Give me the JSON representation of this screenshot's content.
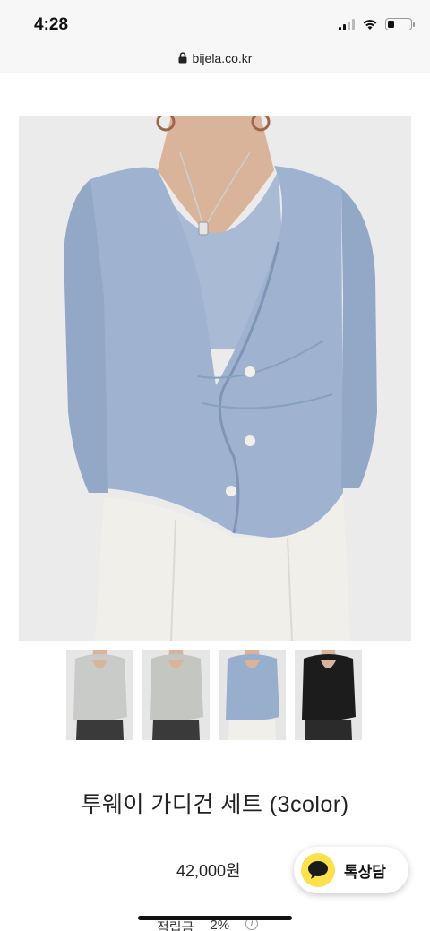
{
  "status_bar": {
    "time": "4:28",
    "battery_level": 0.3
  },
  "browser": {
    "url": "bijela.co.kr"
  },
  "product": {
    "title": "투웨이 가디건 세트 (3color)",
    "price": "42,000원",
    "points_label": "적립금",
    "points_value": "2%",
    "info_symbol": "i"
  },
  "thumbnails": [
    {
      "color": "#c9cbc8",
      "alt": "gray-cardigan"
    },
    {
      "color": "#c4c6c2",
      "alt": "gray-cardigan-back"
    },
    {
      "color": "#98aecd",
      "alt": "blue-cardigan"
    },
    {
      "color": "#1c1c1c",
      "alt": "black-cardigan"
    }
  ],
  "chat_button": {
    "label": "톡상담",
    "color": "#fbe14b"
  },
  "colors": {
    "cardigan_blue": "#9fb3d1",
    "pants_white": "#f1efe9",
    "background": "#ebebeb"
  }
}
